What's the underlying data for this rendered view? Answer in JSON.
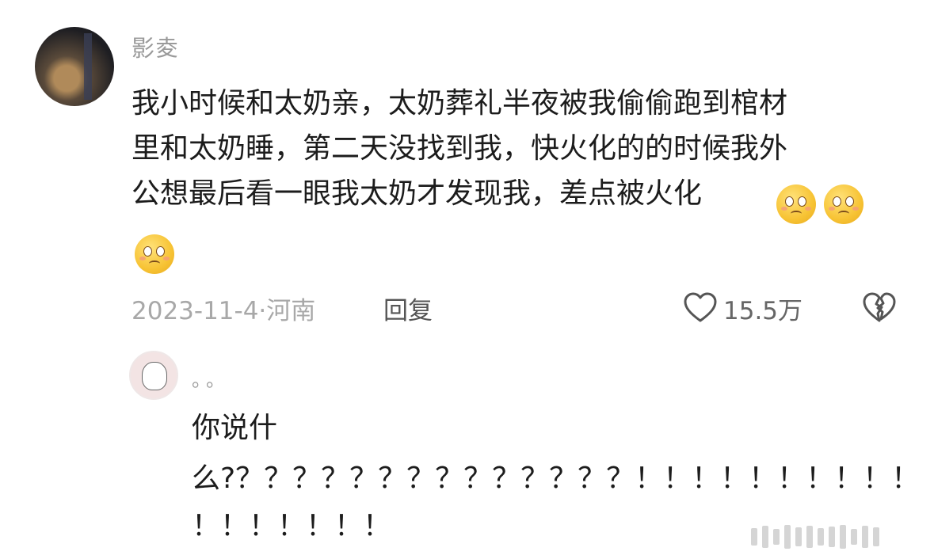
{
  "comment": {
    "username": "影夌",
    "lines": [
      "我小时候和太奶亲，太奶葬礼半夜被我偷偷跑到棺材",
      "里和太奶睡，第二天没找到我，快火化的的时候我外",
      "公想最后看一眼我太奶才发现我，差点被火化"
    ],
    "emojis": [
      "pleading-face-emoji",
      "pleading-face-emoji",
      "pleading-face-emoji"
    ],
    "date_location": "2023-11-4·河南",
    "reply_label": "回复",
    "like_count": "15.5万"
  },
  "reply": {
    "username": "。。",
    "lines": [
      "你说什",
      "么?？？？？？？？？？？？？？？！！！！！！！！！！",
      "！！！！！！！"
    ]
  }
}
